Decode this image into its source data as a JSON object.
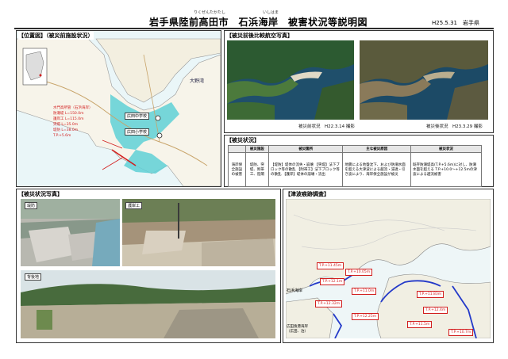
{
  "header": {
    "title": "岩手県陸前高田市　石浜海岸　被害状況等説明図",
    "ruby_city": "りくぜんたかたし",
    "ruby_coast": "いしはま",
    "date": "H25.5.31",
    "org": "岩手県"
  },
  "panels": {
    "location": {
      "title": "【位置図】（被災前施設状況）"
    },
    "aerial": {
      "title": "【被災前後比較航空写真】",
      "caption_before": "被災前状況　H22.3.14 撮影",
      "caption_after": "被災後状況　H23.3.29 撮影"
    },
    "damage": {
      "title": "【被災状況】"
    },
    "photos": {
      "title": "【被災状況写真】",
      "tag1": "堤防",
      "tag2": "護岸工",
      "tag3": "背後地"
    },
    "tsunami": {
      "title": "【津波痕跡調査】"
    }
  },
  "map_labels": {
    "bay": "大野湾",
    "school1": "広田中学校",
    "school2": "広田小学校",
    "facility_info": [
      "水門高所管（石浜海岸）",
      "防潮堤 L=150.0m",
      "護岸工 L=115.0m",
      "突堤 L=35.0m",
      "堤防 L=38.0m",
      "T.P.+5.6m"
    ]
  },
  "damage_table": {
    "headers": [
      "",
      "被災施設",
      "被災箇所",
      "主な被災原因",
      "被災状況"
    ],
    "row": [
      "海岸保全施設の被害",
      "堤防、突堤、附帯工、陸閘",
      "【堤防】堤体の流失・崩壊\n【突堤】法下ブロック等の散乱\n【附帯工】法下ブロック等の散乱\n【護岸】堤体の崩壊・流出",
      "地震による地盤沈下、および防潮水面を超える大津波による越流・浸透・引き波により、海岸保全施設が被災",
      "既存防潮堤高(T.P.+5.6m)に対し、防潮水面を超える T.P.+10.0～+12.5mの津波による越流被害"
    ]
  },
  "tsunami_labels": [
    "T.P.+11.45m",
    "T.P.+10.05m",
    "T.P.+12.1m",
    "T.P.+11.0m",
    "T.P.+11.83m",
    "T.P.+12.32m",
    "T.P.+12.4m",
    "T.P.+12.25m",
    "T.P.+11.5m",
    "T.P.+10.7m"
  ],
  "tsunami_place1": "石浜海岸",
  "tsunami_place2": "広田漁港海岸\n（広田、泊）"
}
